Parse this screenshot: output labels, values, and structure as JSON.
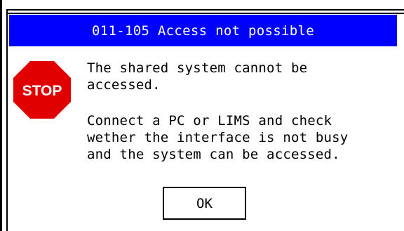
{
  "colors": {
    "title_bar": "#0000ff",
    "title_text": "#ffffff",
    "stop_red": "#e00000"
  },
  "dialog": {
    "title": "011-105 Access not possible",
    "message_1": "The shared system cannot be\naccessed.",
    "message_2": "Connect a PC or LIMS and check\nwether the interface is not busy\nand the system can be accessed.",
    "ok_label": "OK",
    "icon": {
      "name": "stop-icon",
      "text": "STOP"
    }
  }
}
